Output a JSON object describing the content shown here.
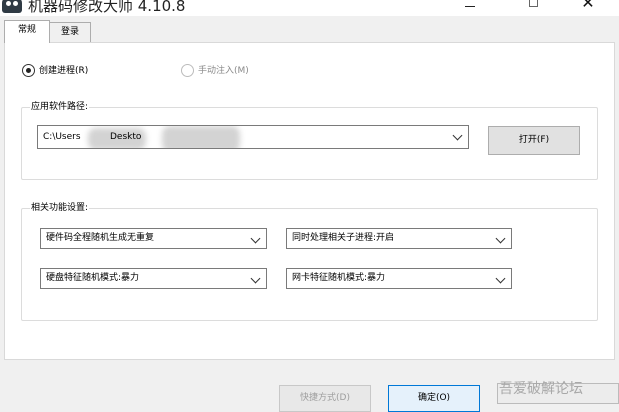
{
  "window": {
    "title": "机器码修改大师 4.10.8",
    "controls": {
      "minimize": "—",
      "maximize": "☐",
      "close": "✕"
    }
  },
  "tabs": [
    {
      "label": "常规",
      "active": true
    },
    {
      "label": "登录",
      "active": false
    }
  ],
  "mode": {
    "create_process": {
      "label": "创建进程(R)",
      "checked": true,
      "enabled": true
    },
    "manual_inject": {
      "label": "手动注入(M)",
      "checked": false,
      "enabled": false
    }
  },
  "path_group": {
    "label": "应用软件路径:",
    "path_prefix": "C:\\Users",
    "path_middle": "Desktop",
    "path_middle_partial": "Deskto",
    "open_button": "打开(F)"
  },
  "functions_group": {
    "label": "相关功能设置:",
    "selects": {
      "hardware_code": "硬件码全程随机生成无重复",
      "related_process": "同时处理相关子进程:开启",
      "disk_mode": "硬盘特征随机模式:暴力",
      "nic_mode": "网卡特征随机模式:暴力"
    }
  },
  "bottom_buttons": {
    "quick_mode": "快捷方式(D)",
    "ok": "确定(O)",
    "third": ""
  },
  "watermark": "吾爱破解论坛",
  "colors": {
    "window_bg": "#f0f0f0",
    "panel_bg": "#ffffff",
    "primary_border": "#0078d7"
  }
}
